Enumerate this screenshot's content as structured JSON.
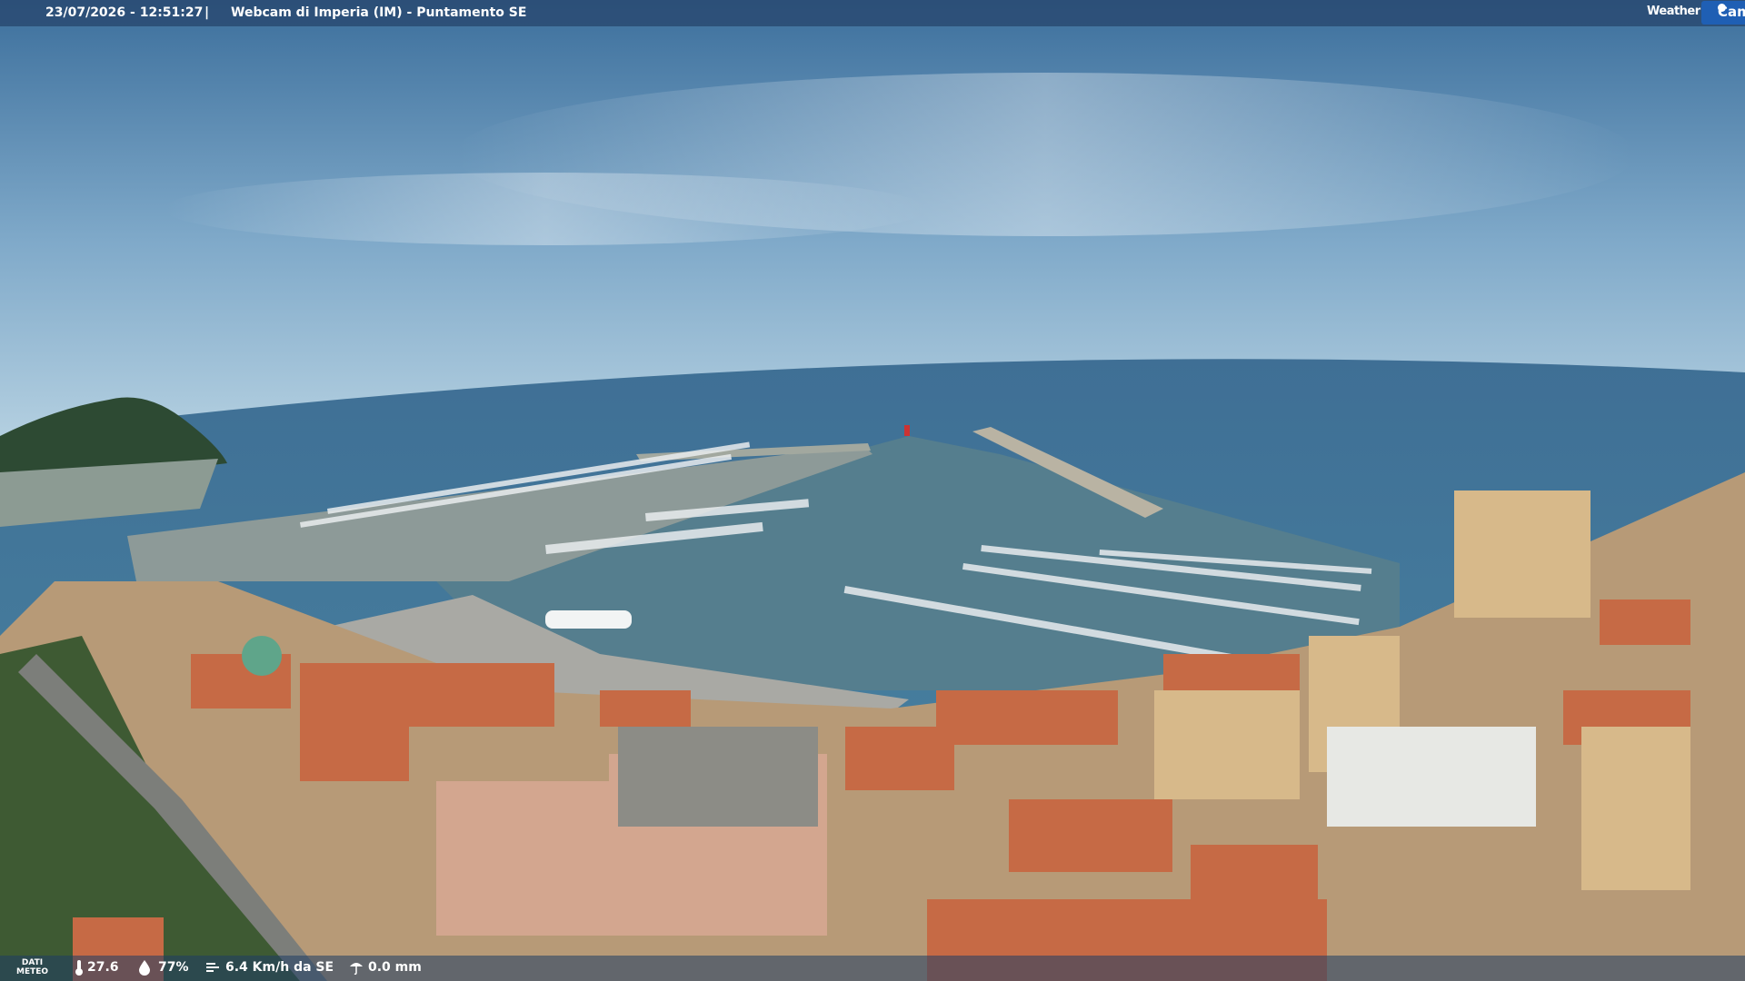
{
  "overlay": {
    "timestamp": "23/07/2026 - 12:51:27",
    "separator": "|",
    "title": "Webcam di Imperia (IM) - Puntamento SE",
    "logo_left": "Weather",
    "logo_right": "Cam"
  },
  "weather": {
    "label_line1": "DATI",
    "label_line2": "METEO",
    "temperature": "27.6",
    "humidity": "77%",
    "wind": "6.4 Km/h da SE",
    "rain": "0.0 mm",
    "icons": [
      "thermometer-icon",
      "humidity-icon",
      "wind-icon",
      "rain-icon"
    ]
  },
  "colors": {
    "sky_top": "#3f72a0",
    "sky_horizon": "#a9c9dd",
    "sea": "#3a7396",
    "harbor_water": "#5b8a9a",
    "roof": "#c66a45",
    "logo_accent": "#1f5fb4"
  }
}
